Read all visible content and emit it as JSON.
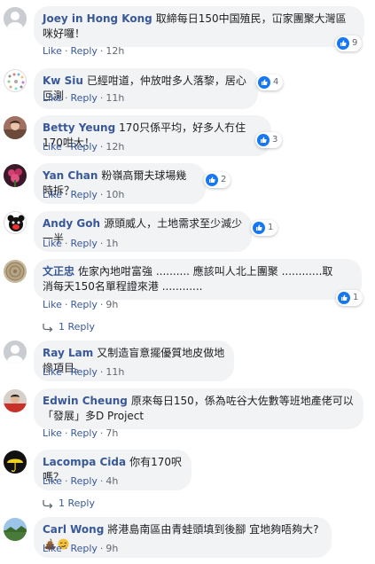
{
  "actions": {
    "like": "Like",
    "reply": "Reply",
    "sep": "·"
  },
  "comments": [
    {
      "author": "Joey in Hong Kong",
      "text": "取締每日150中国殖民，冚家團聚大灣區咪好囉！",
      "reactions": "9",
      "time": "12h"
    },
    {
      "author": "Kw Siu",
      "text": "已經咁道，仲放咁多人落黎，居心叵測",
      "reactions": "4",
      "time": "11h"
    },
    {
      "author": "Betty Yeung",
      "text": "170只係平均，好多人冇住170咁大！",
      "reactions": "3",
      "time": "12h"
    },
    {
      "author": "Yan Chan",
      "text": "粉嶺高爾夫球場幾時拆？",
      "reactions": "2",
      "time": "10h"
    },
    {
      "author": "Andy Goh",
      "text": "源頭威人，土地需求至少減少一半",
      "reactions": "1",
      "time": "1h"
    },
    {
      "author": "文正忠",
      "text": "佐家內地咁富強 .......... 應該叫人北上團聚 ............取消每天150名單程證來港 ............",
      "reactions": "1",
      "time": "9h",
      "reply_count_label": "1 Reply"
    },
    {
      "author": "Ray Lam",
      "text": "又制造盲意擺優質地皮做地慘項目。",
      "reactions": "",
      "time": "11h"
    },
    {
      "author": "Edwin Cheung",
      "text": "原來每日150，係為咗谷大佐數等班地產佬可以「發展」多D Project",
      "reactions": "",
      "time": "7h"
    },
    {
      "author": "Lacompa Cida",
      "text": "你有170呎嗎？",
      "reactions": "",
      "time": "4h",
      "reply_count_label": "1 Reply"
    },
    {
      "author": "Carl Wong",
      "text": "將港島南區由青蛙頭填到後腳 宜地夠唔夠大?",
      "reactions": "",
      "time": "9h"
    }
  ],
  "colors": {
    "link": "#385898",
    "bubble": "#f2f3f5",
    "like": "#1877f2",
    "meta": "#606770"
  }
}
